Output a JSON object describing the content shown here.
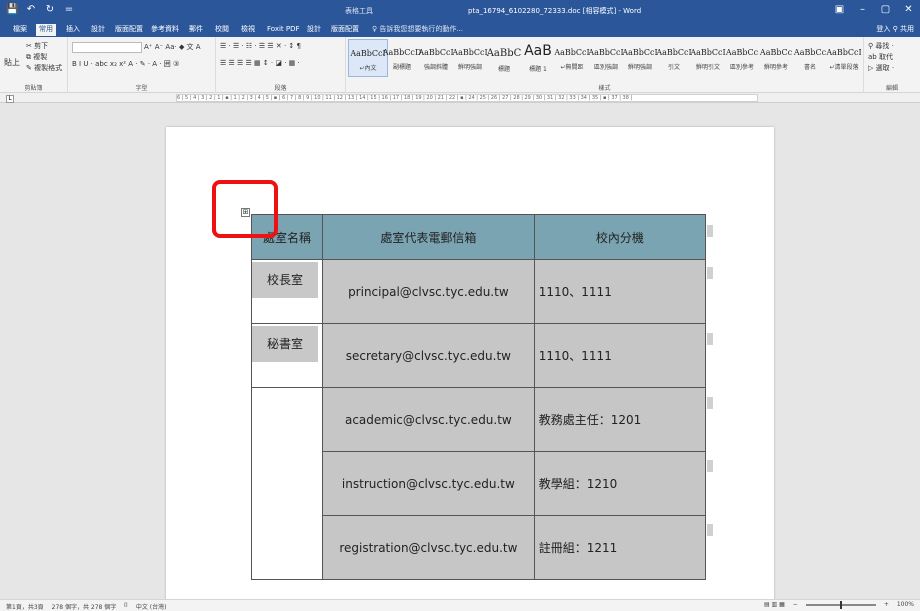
{
  "titlebar": {
    "qat": [
      "💾",
      "↶",
      "↻",
      "="
    ],
    "context_tab_label": "表格工具",
    "document_title": "pta_16794_6102280_72333.doc [相容模式] - Word",
    "controls": [
      "▣",
      "–",
      "▢",
      "✕"
    ]
  },
  "tabs": [
    {
      "label": "檔案"
    },
    {
      "label": "常用"
    },
    {
      "label": "插入"
    },
    {
      "label": "設計"
    },
    {
      "label": "版面配置"
    },
    {
      "label": "參考資料"
    },
    {
      "label": "郵件"
    },
    {
      "label": "校閱"
    },
    {
      "label": "檢視"
    },
    {
      "label": "Foxit PDF"
    },
    {
      "label": "設計"
    },
    {
      "label": "版面配置"
    }
  ],
  "tellme": "♀ 告訴我您想要執行的動作...",
  "signin": "登入  ⚲ 共用",
  "ribbon": {
    "clipboard": {
      "cut": "✂ 剪下",
      "copy": "⧉ 複製",
      "paste": "貼上",
      "painter": "✎ 複製格式",
      "label": "剪貼簿"
    },
    "font": {
      "label": "字型",
      "row1": "A⁺ A⁻ Aa· ◆ 文 A",
      "row2": "B I U · abc x₂ x² A · ✎ · A · 囲 ③"
    },
    "paragraph": {
      "label": "段落",
      "row1": "☰ · ☰ · ☷ · ☰ ☰ ✕ · ↕ ¶",
      "row2": "☰ ☰ ☰ ☰ ▦ ↕ · ◪ · ▦ ·"
    },
    "styles": {
      "label": "樣式",
      "items": [
        {
          "sample": "AaBbCcI",
          "name": "↵內文"
        },
        {
          "sample": "AaBbCcD",
          "name": "副標題"
        },
        {
          "sample": "AaBbCcI",
          "name": "強調斜體"
        },
        {
          "sample": "AaBbCcI",
          "name": "鮮明強調"
        },
        {
          "sample": "AaBbC",
          "name": "標題"
        },
        {
          "sample": "AaB",
          "name": "標題 1"
        },
        {
          "sample": "AaBbCcI",
          "name": "↵無間距"
        },
        {
          "sample": "AaBbCcI",
          "name": "區別強調"
        },
        {
          "sample": "AaBbCcI",
          "name": "鮮明強調"
        },
        {
          "sample": "AaBbCcI",
          "name": "引文"
        },
        {
          "sample": "AaBbCcI",
          "name": "鮮明引文"
        },
        {
          "sample": "AaBbCc",
          "name": "區別參考"
        },
        {
          "sample": "AaBbCc",
          "name": "鮮明參考"
        },
        {
          "sample": "AaBbCc",
          "name": "書名"
        },
        {
          "sample": "AaBbCcI",
          "name": "↵清單段落"
        }
      ]
    },
    "editing": {
      "label": "編輯",
      "find": "⚲ 尋找 ·",
      "replace": "ab 取代",
      "select": "▷ 選取 ·"
    }
  },
  "ruler": {
    "text": "6 | 5 | 4 | 3 | 2 | 1 | ▪ | 1 | 2 | 3 | 4 | 5 | ▪ | 6 | 7 | 8 | 9 | 10 | 11 | 12 | 13 | 14 | 15 | 16 | 17 | 18 | 19 | 20 | 21 | 22 | ▪ | 24 | 25 | 26 | 27 | 28 | 29 | 30 | 31 | 32 | 33 | 34 | 35 | ▪ | 37 | 38 |"
  },
  "table": {
    "headers": [
      "處室名稱",
      "處室代表電郵信箱",
      "校內分機"
    ],
    "rows": [
      {
        "name": "校長室",
        "email": "principal@clvsc.tyc.edu.tw",
        "ext": "1110、1111"
      },
      {
        "name": "秘書室",
        "email": "secretary@clvsc.tyc.edu.tw",
        "ext": "1110、1111"
      },
      {
        "name": "",
        "email": "academic@clvsc.tyc.edu.tw",
        "ext": "教務處主任：1201"
      },
      {
        "name": "",
        "email": "instruction@clvsc.tyc.edu.tw",
        "ext": "教學組：1210"
      },
      {
        "name": "",
        "email": "registration@clvsc.tyc.edu.tw",
        "ext": "註冊組：1211"
      }
    ],
    "move_handle": "⊞"
  },
  "statusbar": {
    "page": "第1頁，共3頁",
    "words": "278 個字，共 278 個字",
    "proof": "⌷",
    "lang": "中文 (台灣)",
    "views": "▤  ▥  ▦",
    "zoom": "100%"
  },
  "colors": {
    "ribbon_blue": "#2b579a",
    "header_fill": "#7ba4b2",
    "cell_fill": "#c6c6c6",
    "highlight_box": "#ee1111"
  }
}
